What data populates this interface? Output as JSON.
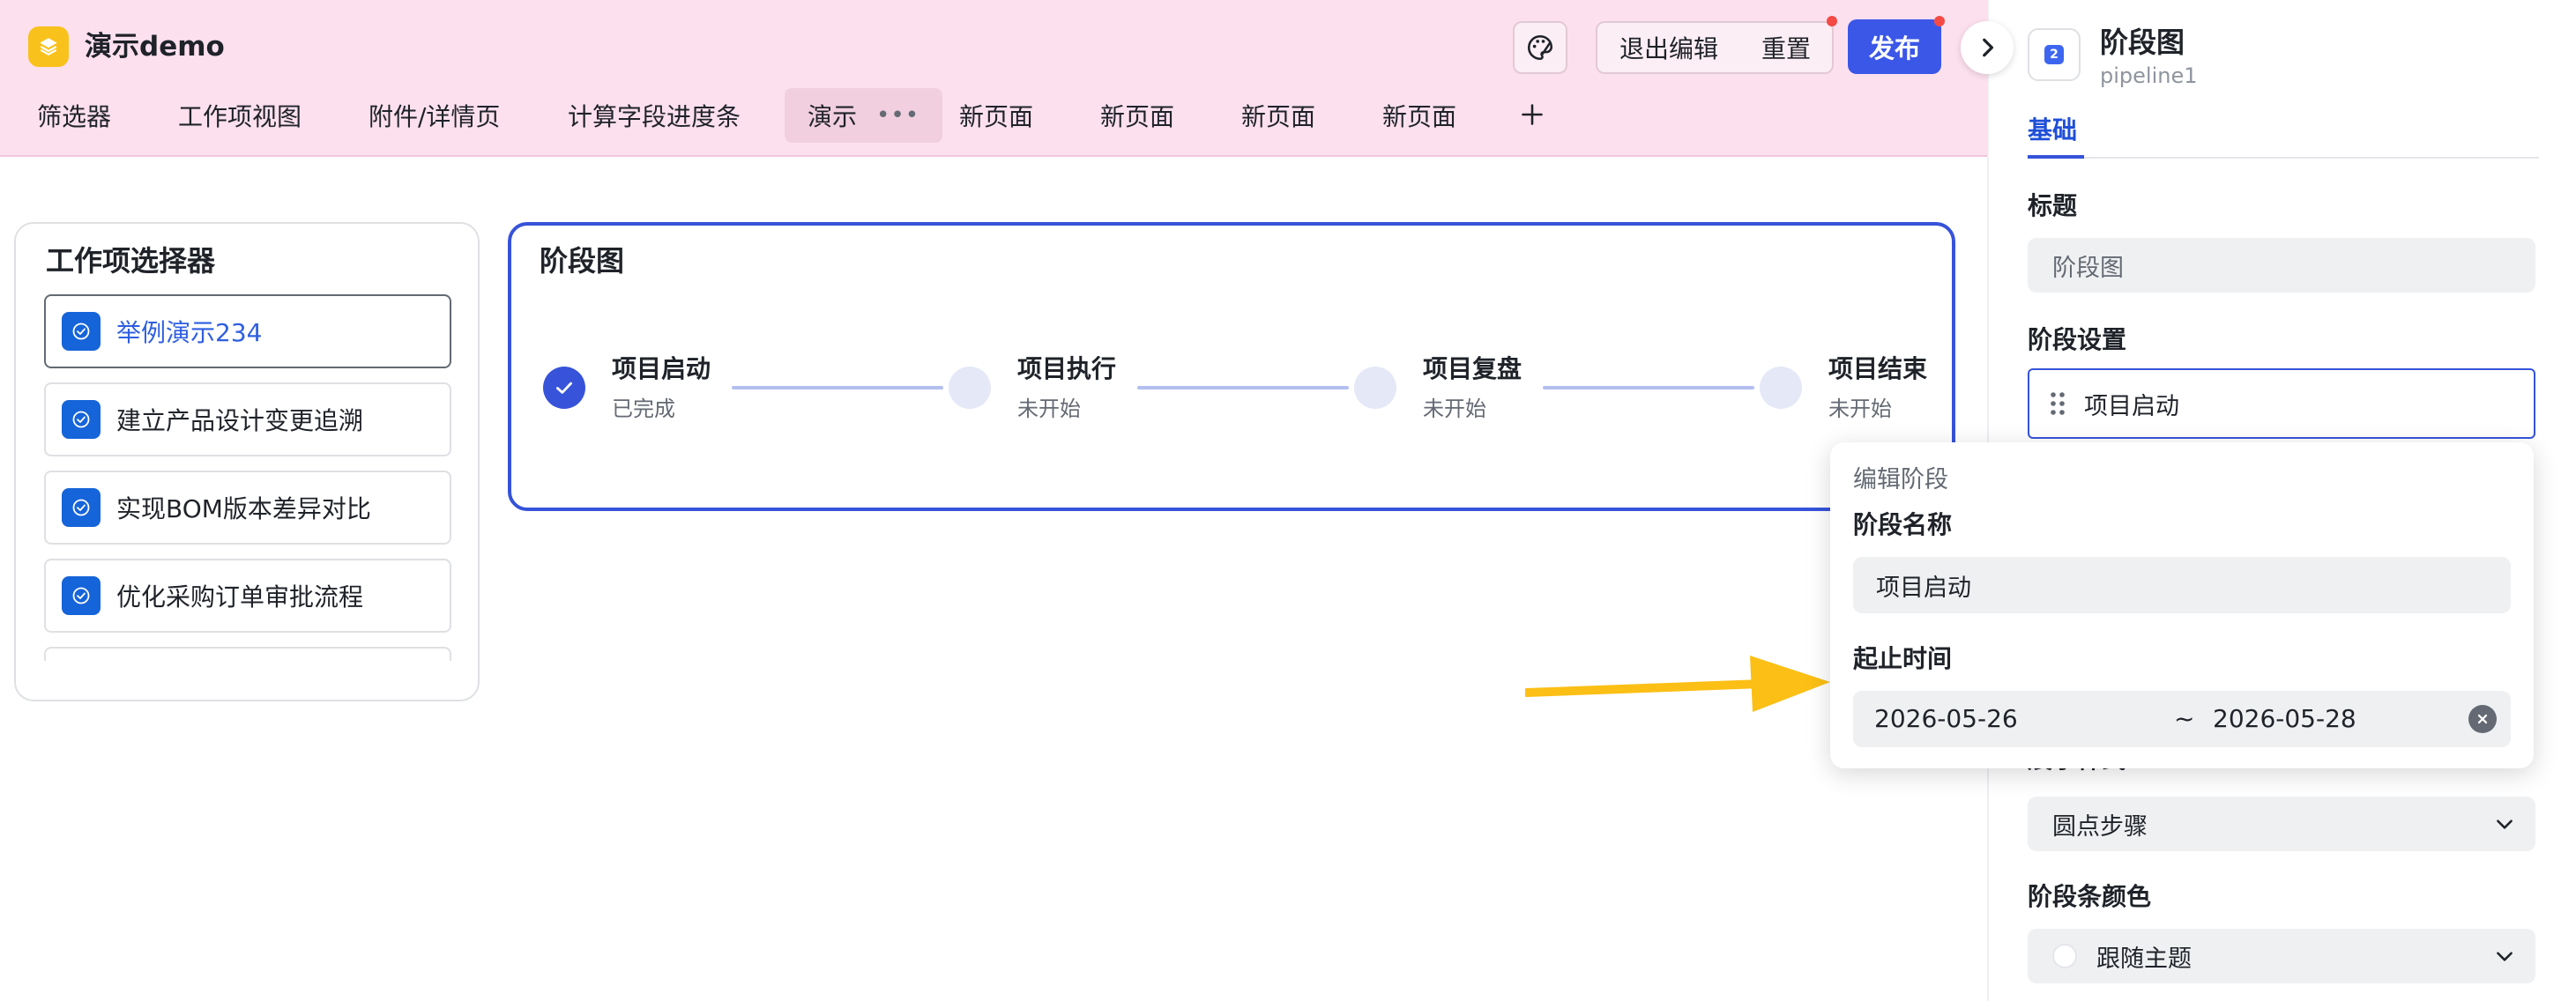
{
  "app": {
    "title": "演示demo"
  },
  "toolbar": {
    "exit_label": "退出编辑",
    "reset_label": "重置",
    "publish_label": "发布"
  },
  "tabs": [
    {
      "label": "筛选器"
    },
    {
      "label": "工作项视图"
    },
    {
      "label": "附件/详情页"
    },
    {
      "label": "计算字段进度条"
    },
    {
      "label": "演示",
      "active": true
    },
    {
      "label": "新页面"
    },
    {
      "label": "新页面"
    },
    {
      "label": "新页面"
    },
    {
      "label": "新页面"
    }
  ],
  "selector_card": {
    "title": "工作项选择器",
    "items": [
      {
        "label": "举例演示234",
        "selected": true
      },
      {
        "label": "建立产品设计变更追溯"
      },
      {
        "label": "实现BOM版本差异对比"
      },
      {
        "label": "优化采购订单审批流程"
      },
      {
        "label": ""
      }
    ]
  },
  "stage_card": {
    "title": "阶段图",
    "steps": [
      {
        "name": "项目启动",
        "status": "已完成",
        "done": true
      },
      {
        "name": "项目执行",
        "status": "未开始",
        "done": false
      },
      {
        "name": "项目复盘",
        "status": "未开始",
        "done": false
      },
      {
        "name": "项目结束",
        "status": "未开始",
        "done": false
      }
    ]
  },
  "panel": {
    "component_name": "阶段图",
    "component_id": "pipeline1",
    "badge": "2",
    "tab_basic": "基础",
    "title_label": "标题",
    "title_value": "阶段图",
    "stage_settings_label": "阶段设置",
    "stage_item": "项目启动",
    "style_label": "展示样式",
    "style_value": "圆点步骤",
    "bar_color_label": "阶段条颜色",
    "bar_color_value": "跟随主题"
  },
  "popover": {
    "caption": "编辑阶段",
    "name_label": "阶段名称",
    "name_value": "项目启动",
    "time_label": "起止时间",
    "start_date": "2026-05-26",
    "range_sep": "~",
    "end_date": "2026-05-28"
  },
  "colors": {
    "accent": "#3653d9",
    "header_bg": "#fde0ee",
    "logo": "#f9c11b",
    "annotation_arrow": "#fbbf15"
  },
  "icons": [
    "layers-icon",
    "palette-icon",
    "chevron-right-icon",
    "plus-icon",
    "check-circle-icon",
    "drag-handle-icon",
    "chevron-down-icon",
    "clear-icon",
    "arrow-annotation"
  ]
}
